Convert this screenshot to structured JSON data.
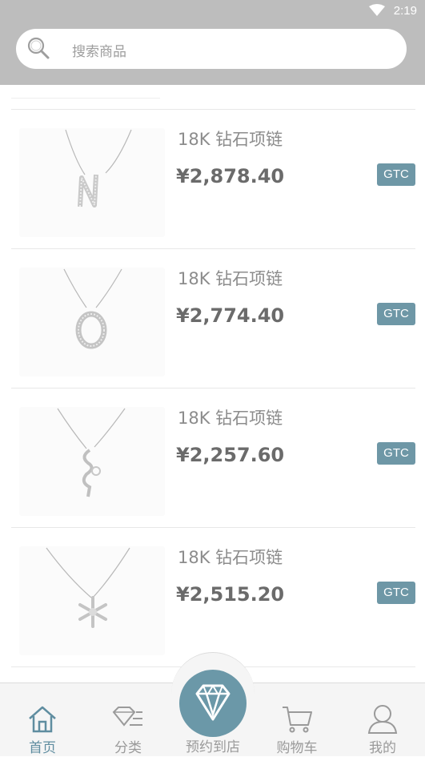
{
  "status_bar": {
    "time": "2:19"
  },
  "search": {
    "placeholder": "搜索商品"
  },
  "products": [
    {
      "title": "18K 钻石项链",
      "price": "¥2,878.40",
      "badge": "GTC"
    },
    {
      "title": "18K 钻石项链",
      "price": "¥2,774.40",
      "badge": "GTC"
    },
    {
      "title": "18K 钻石项链",
      "price": "¥2,257.60",
      "badge": "GTC"
    },
    {
      "title": "18K 钻石项链",
      "price": "¥2,515.20",
      "badge": "GTC"
    }
  ],
  "tabs": [
    {
      "label": "首页",
      "icon": "home-icon",
      "active": true
    },
    {
      "label": "分类",
      "icon": "diamond-list-icon",
      "active": false
    },
    {
      "label": "预约到店",
      "icon": "diamond-icon",
      "active": false
    },
    {
      "label": "购物车",
      "icon": "cart-icon",
      "active": false
    },
    {
      "label": "我的",
      "icon": "user-icon",
      "active": false
    }
  ],
  "colors": {
    "accent": "#5f8da0",
    "badge": "#6e97a6",
    "header": "#bdbdbd"
  }
}
